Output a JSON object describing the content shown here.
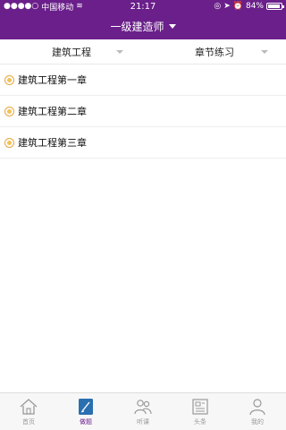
{
  "status": {
    "carrier": "中国移动",
    "time": "21:17",
    "battery": "84%",
    "battery_level": 0.84
  },
  "nav": {
    "title": "一级建造师"
  },
  "filters": [
    {
      "label": "建筑工程"
    },
    {
      "label": "章节练习"
    }
  ],
  "chapters": [
    {
      "label": "建筑工程第一章"
    },
    {
      "label": "建筑工程第二章"
    },
    {
      "label": "建筑工程第三章"
    }
  ],
  "tabs": [
    {
      "label": "首页",
      "icon": "home-icon"
    },
    {
      "label": "做题",
      "icon": "exercise-icon",
      "active": true
    },
    {
      "label": "听课",
      "icon": "lecture-icon"
    },
    {
      "label": "头条",
      "icon": "news-icon"
    },
    {
      "label": "我的",
      "icon": "profile-icon"
    }
  ],
  "colors": {
    "brand": "#6a1f8a",
    "accent_dot": "#f3c15a",
    "active_tab_icon": "#2a6fb0"
  }
}
